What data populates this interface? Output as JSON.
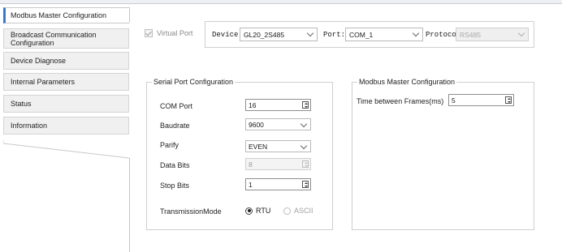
{
  "nav": {
    "items": [
      {
        "label": "Modbus Master Configuration",
        "active": true
      },
      {
        "label": "Broadcast Communication Configuration",
        "active": false
      },
      {
        "label": "Device Diagnose",
        "active": false
      },
      {
        "label": "Internal Parameters",
        "active": false
      },
      {
        "label": "Status",
        "active": false
      },
      {
        "label": "Information",
        "active": false
      }
    ]
  },
  "top": {
    "virtual_port_label": "Virtual Port",
    "virtual_port_checked": true,
    "device_label": "Device:",
    "device_value": "GL20_2S485",
    "port_label": "Port:",
    "port_value": "COM_1",
    "protocol_label": "Protocol:",
    "protocol_value": "RS485"
  },
  "serial": {
    "title": "Serial Port Configuration",
    "com_port_label": "COM Port",
    "com_port_value": "16",
    "baudrate_label": "Baudrate",
    "baudrate_value": "9600",
    "parity_label": "Parify",
    "parity_value": "EVEN",
    "data_bits_label": "Data Bits",
    "data_bits_value": "8",
    "stop_bits_label": "Stop Bits",
    "stop_bits_value": "1",
    "mode_label": "TransmissionMode",
    "mode_rtu_label": "RTU",
    "mode_ascii_label": "ASCII",
    "mode_selected": "RTU"
  },
  "master": {
    "title": "Modbus Master Configuration",
    "time_label": "Time between Frames(ms)",
    "time_value": "5"
  }
}
